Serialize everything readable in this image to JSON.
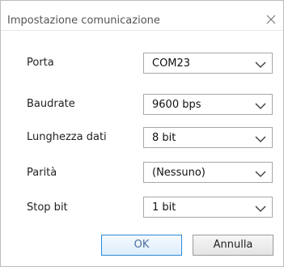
{
  "window": {
    "title": "Impostazione comunicazione",
    "close_icon": "close-icon"
  },
  "fields": [
    {
      "label": "Porta",
      "value": "COM23"
    },
    {
      "label": "Baudrate",
      "value": "9600 bps"
    },
    {
      "label": "Lunghezza dati",
      "value": "8 bit"
    },
    {
      "label": "Parità",
      "value": "(Nessuno)"
    },
    {
      "label": "Stop bit",
      "value": "1 bit"
    }
  ],
  "buttons": {
    "ok_label": "OK",
    "cancel_label": "Annulla"
  },
  "colors": {
    "ok_border": "#2c8ad6",
    "border": "#a7a7a7"
  }
}
